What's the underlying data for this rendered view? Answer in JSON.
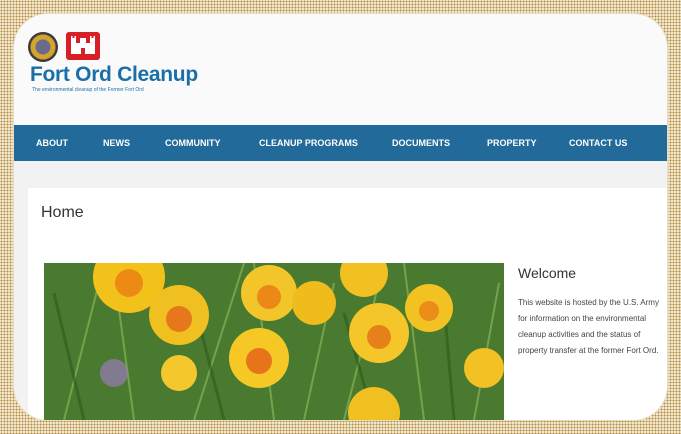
{
  "site": {
    "title": "Fort Ord Cleanup",
    "subtitle": "The environmental cleanup of the Former Fort Ord"
  },
  "nav": {
    "items": [
      {
        "label": "ABOUT"
      },
      {
        "label": "NEWS"
      },
      {
        "label": "COMMUNITY"
      },
      {
        "label": "CLEANUP PROGRAMS"
      },
      {
        "label": "DOCUMENTS"
      },
      {
        "label": "PROPERTY"
      },
      {
        "label": "CONTACT US"
      }
    ]
  },
  "main": {
    "page_title": "Home",
    "welcome": {
      "heading": "Welcome",
      "body": "This website is hosted by the U.S. Army for information on the environmental cleanup activities and the status of property transfer at the former Fort Ord."
    }
  },
  "icons": {
    "army_seal": "army-seal-icon",
    "castle": "corps-of-engineers-castle-icon"
  },
  "colors": {
    "nav_bg": "#216a99",
    "brand_blue": "#1a6fa8",
    "castle_red": "#d61f26"
  }
}
